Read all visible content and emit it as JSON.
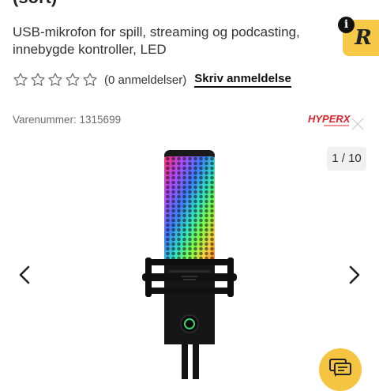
{
  "product": {
    "title_fragment": "(sort)",
    "subtitle": "USB-mikrofon for spill, streaming og podcasting, innebygde kontroller, LED",
    "rating": {
      "stars_filled": 0,
      "stars_total": 5,
      "review_count_text": "(0 anmeldelser)"
    },
    "write_review_label": "Skriv anmeldelse",
    "sku_text": "Varenummer: 1315699",
    "brand": "HYPERX"
  },
  "gallery": {
    "counter_text": "1 / 10"
  },
  "badge": {
    "letter": "R",
    "info_label": "i"
  },
  "colors": {
    "accent_yellow": "#f5c542",
    "brand_red": "#d8232a",
    "text_dark": "#222222",
    "text_muted": "#6b6b6b"
  }
}
